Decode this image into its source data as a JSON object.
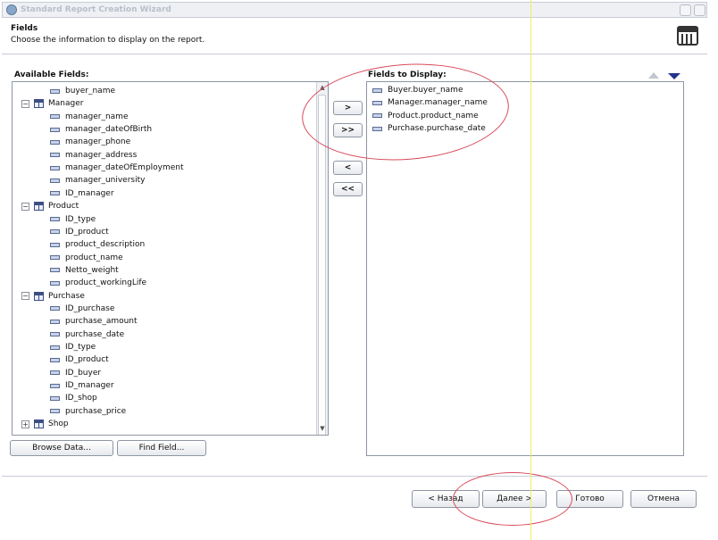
{
  "window": {
    "title": "Standard Report Creation Wizard"
  },
  "header": {
    "title": "Fields",
    "description": "Choose the information to display on the report.",
    "icon": "report-layout-icon"
  },
  "available_fields": {
    "label": "Available Fields:",
    "items": [
      {
        "kind": "field",
        "label": "buyer_name"
      },
      {
        "kind": "table",
        "label": "Manager",
        "expander": "−"
      },
      {
        "kind": "field",
        "label": "manager_name"
      },
      {
        "kind": "field",
        "label": "manager_dateOfBirth"
      },
      {
        "kind": "field",
        "label": "manager_phone"
      },
      {
        "kind": "field",
        "label": "manager_address"
      },
      {
        "kind": "field",
        "label": "manager_dateOfEmployment"
      },
      {
        "kind": "field",
        "label": "manager_university"
      },
      {
        "kind": "field",
        "label": "ID_manager"
      },
      {
        "kind": "table",
        "label": "Product",
        "expander": "−"
      },
      {
        "kind": "field",
        "label": "ID_type"
      },
      {
        "kind": "field",
        "label": "ID_product"
      },
      {
        "kind": "field",
        "label": "product_description"
      },
      {
        "kind": "field",
        "label": "product_name"
      },
      {
        "kind": "field",
        "label": "Netto_weight"
      },
      {
        "kind": "field",
        "label": "product_workingLife"
      },
      {
        "kind": "table",
        "label": "Purchase",
        "expander": "−"
      },
      {
        "kind": "field",
        "label": "ID_purchase"
      },
      {
        "kind": "field",
        "label": "purchase_amount"
      },
      {
        "kind": "field",
        "label": "purchase_date"
      },
      {
        "kind": "field",
        "label": "ID_type"
      },
      {
        "kind": "field",
        "label": "ID_product"
      },
      {
        "kind": "field",
        "label": "ID_buyer"
      },
      {
        "kind": "field",
        "label": "ID_manager"
      },
      {
        "kind": "field",
        "label": "ID_shop"
      },
      {
        "kind": "field",
        "label": "purchase_price"
      },
      {
        "kind": "table",
        "label": "Shop",
        "expander": "+"
      }
    ]
  },
  "transfer_buttons": {
    "add": ">",
    "add_all": ">>",
    "remove": "<",
    "remove_all": "<<"
  },
  "fields_to_display": {
    "label": "Fields to Display:",
    "items": [
      "Buyer.buyer_name",
      "Manager.manager_name",
      "Product.product_name",
      "Purchase.purchase_date"
    ]
  },
  "bottom_buttons": {
    "browse_data": "Browse Data...",
    "find_field": "Find Field..."
  },
  "nav_buttons": {
    "back": "< Назад",
    "next": "Далее >",
    "finish": "Готово",
    "cancel": "Отмена"
  },
  "colors": {
    "annotation_circle": "#d84a5a",
    "guide_line": "#f2ee5a"
  }
}
